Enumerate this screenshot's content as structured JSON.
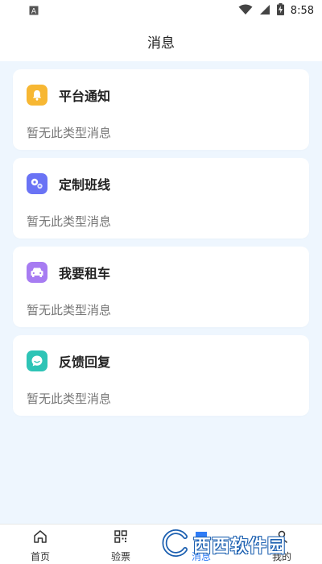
{
  "status_bar": {
    "time": "8:58",
    "left_icon": "a-box-icon",
    "right_icons": [
      "wifi-icon",
      "signal-icon",
      "battery-charging-icon"
    ]
  },
  "header": {
    "title": "消息"
  },
  "cards": [
    {
      "title": "平台通知",
      "subtitle": "暂无此类型消息",
      "icon": "bell-icon",
      "icon_color": "#f7b733"
    },
    {
      "title": "定制班线",
      "subtitle": "暂无此类型消息",
      "icon": "route-icon",
      "icon_color": "#6a73f5"
    },
    {
      "title": "我要租车",
      "subtitle": "暂无此类型消息",
      "icon": "car-icon",
      "icon_color": "#a77cf2"
    },
    {
      "title": "反馈回复",
      "subtitle": "暂无此类型消息",
      "icon": "chat-icon",
      "icon_color": "#2ec4b6"
    }
  ],
  "tabbar": {
    "active_color": "#2f7cf6",
    "tabs": [
      {
        "label": "首页",
        "icon": "home-icon"
      },
      {
        "label": "验票",
        "icon": "qr-code-icon"
      },
      {
        "label": "消息",
        "icon": "message-icon",
        "active": true
      },
      {
        "label": "我的",
        "icon": "user-icon"
      }
    ]
  },
  "watermark": {
    "text": "西西软件园",
    "small_text": "CR173.COM"
  },
  "colors": {
    "background": "#eef6fe",
    "card": "#ffffff"
  }
}
